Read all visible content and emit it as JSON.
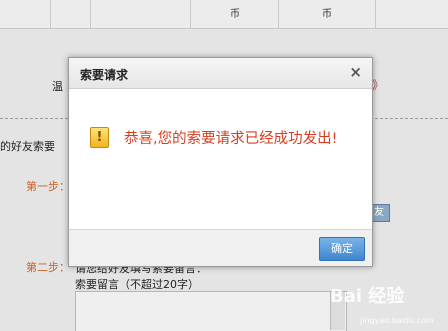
{
  "background": {
    "table_cells": [
      "币",
      "币"
    ],
    "row_partial": "…",
    "wen_label": "温",
    "arrow": "》",
    "friend_line": "的好友索要",
    "step1_label": "第一步：",
    "step2_label": "第二步：",
    "step2_hint": "请您给好友填写索要留言：",
    "message_label": "索要留言（不超过20字）",
    "friend_button_label": "友"
  },
  "dialog": {
    "title": "索要请求",
    "close_glyph": "×",
    "message": "恭喜,您的索要请求已经成功发出!",
    "confirm_label": "确定",
    "warning_glyph": "!"
  },
  "watermark": {
    "main": "Bai 经验",
    "sub": "jingyan.baidu.com"
  }
}
